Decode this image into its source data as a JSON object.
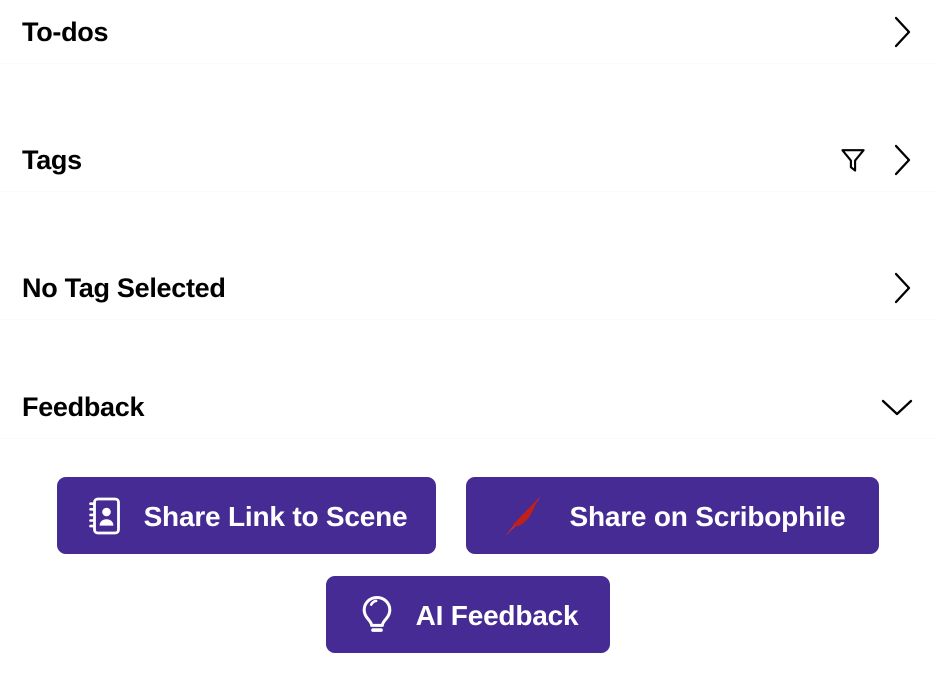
{
  "panel": {
    "sections": [
      {
        "key": "todos",
        "label": "To-dos",
        "chevron": "chevron-right-icon",
        "has_filter": false
      },
      {
        "key": "tags",
        "label": "Tags",
        "chevron": "chevron-right-icon",
        "has_filter": true,
        "filter_icon": "filter-funnel-icon"
      },
      {
        "key": "no-tag-selected",
        "label": "No Tag Selected",
        "chevron": "chevron-right-icon",
        "has_filter": false
      },
      {
        "key": "feedback",
        "label": "Feedback",
        "chevron": "chevron-down-icon",
        "has_filter": false
      }
    ]
  },
  "feedback": {
    "buttons": [
      {
        "key": "share-link-to-scene",
        "label": "Share Link to Scene",
        "icon": "address-book-icon"
      },
      {
        "key": "share-on-scribophile",
        "label": "Share on Scribophile",
        "icon": "scribophile-quill-icon"
      },
      {
        "key": "ai-feedback",
        "label": "AI Feedback",
        "icon": "lightbulb-icon"
      }
    ]
  },
  "colors": {
    "button_purple": "#452B93",
    "button_text": "#FFFFFF",
    "scribophile_red": "#CC2222",
    "text_primary": "#000000",
    "background": "#FFFFFF"
  }
}
